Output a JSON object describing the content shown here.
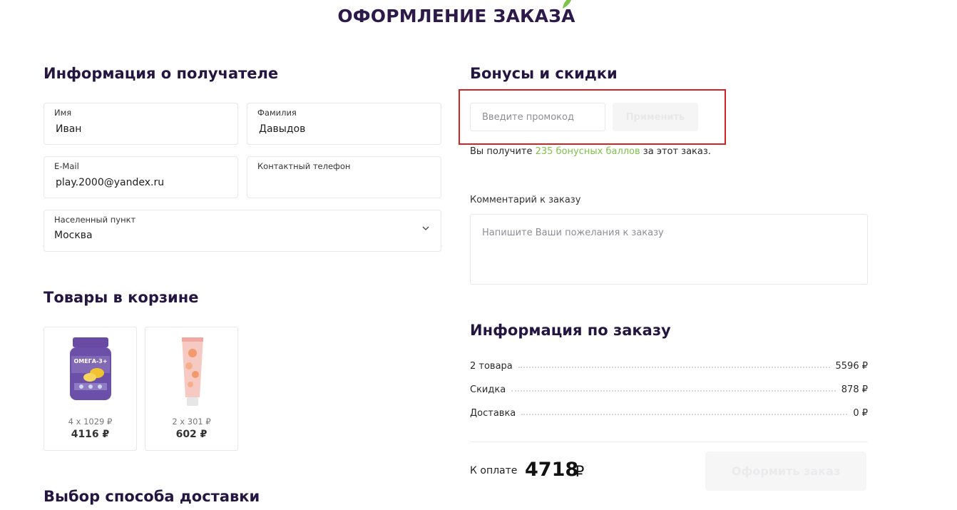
{
  "page": {
    "title": "ОФОРМЛЕНИЕ ЗАКАЗА"
  },
  "recipient": {
    "title": "Информация о получателе",
    "first_name": {
      "label": "Имя",
      "value": "Иван"
    },
    "last_name": {
      "label": "Фамилия",
      "value": "Давыдов"
    },
    "email": {
      "label": "E-Mail",
      "value": "play.2000@yandex.ru"
    },
    "phone": {
      "label": "Контактный телефон",
      "value": ""
    },
    "city": {
      "label": "Населенный пункт",
      "value": "Москва"
    }
  },
  "cart": {
    "title": "Товары в корзине",
    "items": [
      {
        "qty_price": "4 x 1029 ₽",
        "total": "4116 ₽",
        "image_text": "ОМЕГА-3+",
        "image_icon": "supplement-jar-icon"
      },
      {
        "qty_price": "2 x 301 ₽",
        "total": "602 ₽",
        "image_icon": "cream-tube-icon"
      }
    ]
  },
  "delivery": {
    "title": "Выбор способа доставки"
  },
  "bonuses": {
    "title": "Бонусы и скидки",
    "promo_placeholder": "Введите промокод",
    "apply_label": "Применить",
    "bonus_prefix": "Вы получите ",
    "bonus_amount": "235 бонусных баллов",
    "bonus_suffix": " за этот заказ."
  },
  "comment": {
    "label": "Комментарий к заказу",
    "placeholder": "Напишите Ваши пожелания к заказу"
  },
  "order_info": {
    "title": "Информация по заказу",
    "rows": [
      {
        "label": "2 товара",
        "value": "5596 ₽"
      },
      {
        "label": "Скидка",
        "value": "878 ₽"
      },
      {
        "label": "Доставка",
        "value": "0 ₽"
      }
    ],
    "pay_label": "К оплате",
    "pay_value": "4718",
    "pay_currency": "₽",
    "checkout_label": "Оформить заказ"
  },
  "colors": {
    "accent_green": "#7dc24b",
    "title": "#2d1a4a",
    "highlight": "#d32424"
  }
}
